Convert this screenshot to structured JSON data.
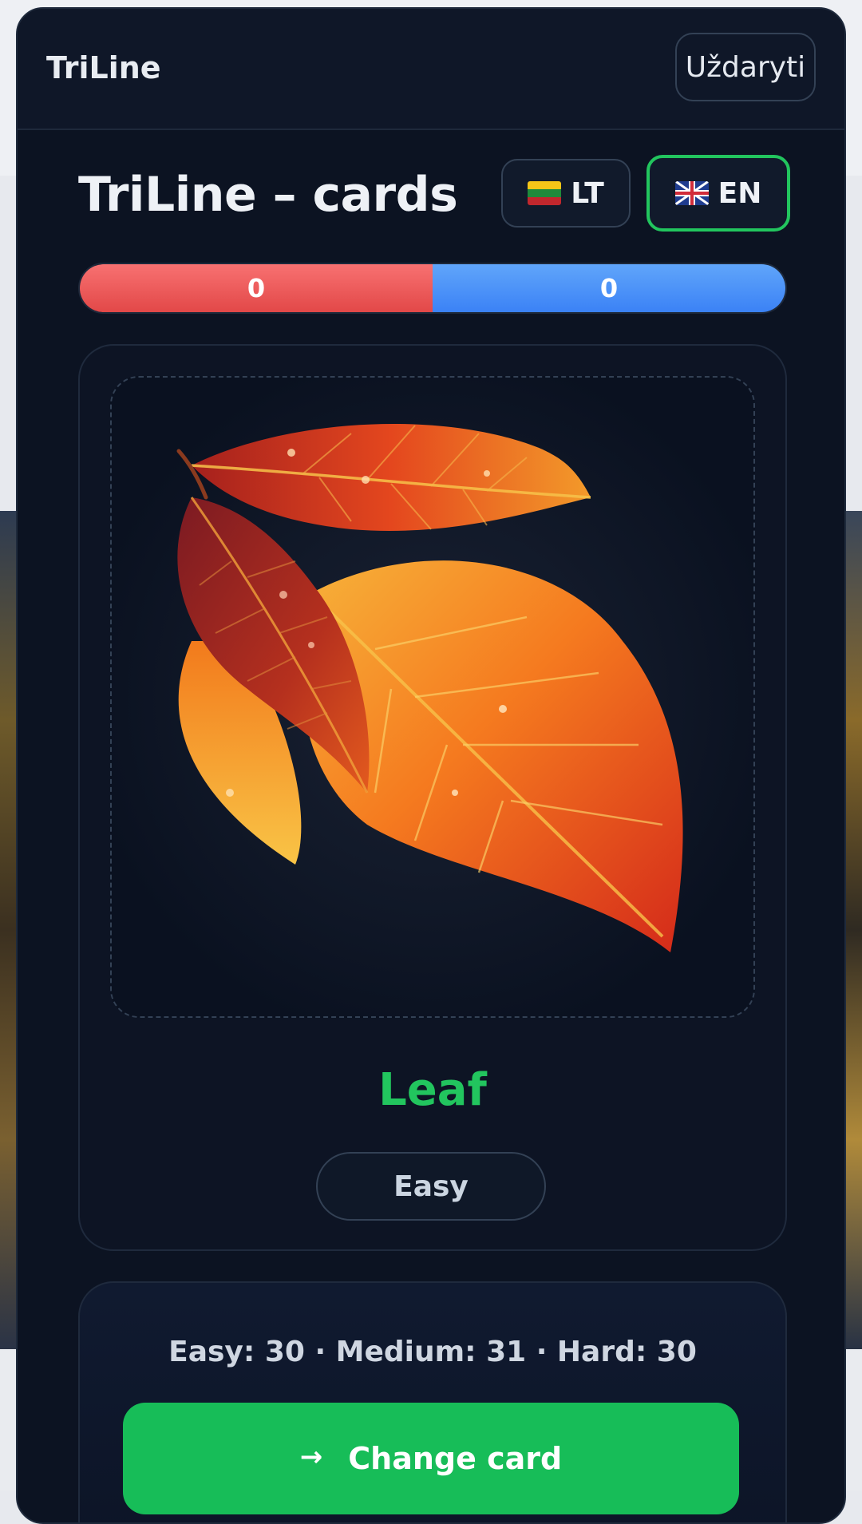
{
  "header": {
    "brand": "TriLine",
    "close_label": "Uždaryti"
  },
  "page": {
    "title": "TriLine – cards"
  },
  "languages": [
    {
      "code": "LT",
      "flag": "lithuania-flag-icon",
      "selected": false
    },
    {
      "code": "EN",
      "flag": "uk-flag-icon",
      "selected": true
    }
  ],
  "score": {
    "red": "0",
    "blue": "0",
    "red_color": "#ef4444",
    "blue_color": "#3b82f6"
  },
  "card": {
    "image": "autumn-leaves-image",
    "word": "Leaf",
    "difficulty": "Easy",
    "word_color": "#22c55e"
  },
  "stats": {
    "text": "Easy: 30 · Medium: 31 · Hard: 30"
  },
  "actions": {
    "change_arrow": "→",
    "change_label": "Change card",
    "accent": "#17bd58"
  }
}
